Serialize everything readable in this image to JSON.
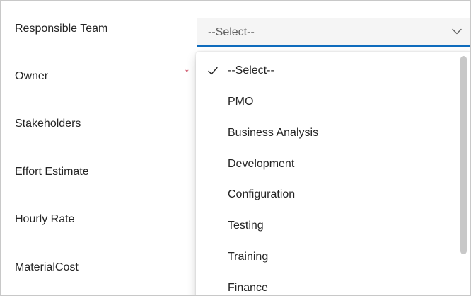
{
  "form": {
    "fields": [
      {
        "label": "Responsible Team"
      },
      {
        "label": "Owner",
        "required_marker": "*"
      },
      {
        "label": "Stakeholders"
      },
      {
        "label": "Effort Estimate"
      },
      {
        "label": "Hourly Rate"
      },
      {
        "label": "MaterialCost"
      }
    ]
  },
  "select": {
    "value": "--Select--",
    "accent_color": "#0f6cbd",
    "chevron_icon": "chevron-down-icon"
  },
  "dropdown": {
    "selected_icon": "checkmark-icon",
    "options": [
      {
        "label": "--Select--",
        "selected": true
      },
      {
        "label": "PMO"
      },
      {
        "label": "Business Analysis"
      },
      {
        "label": "Development"
      },
      {
        "label": "Configuration"
      },
      {
        "label": "Testing"
      },
      {
        "label": "Training"
      },
      {
        "label": "Finance"
      }
    ]
  },
  "colors": {
    "required": "#c4314b",
    "text": "#242424",
    "muted": "#616161"
  }
}
